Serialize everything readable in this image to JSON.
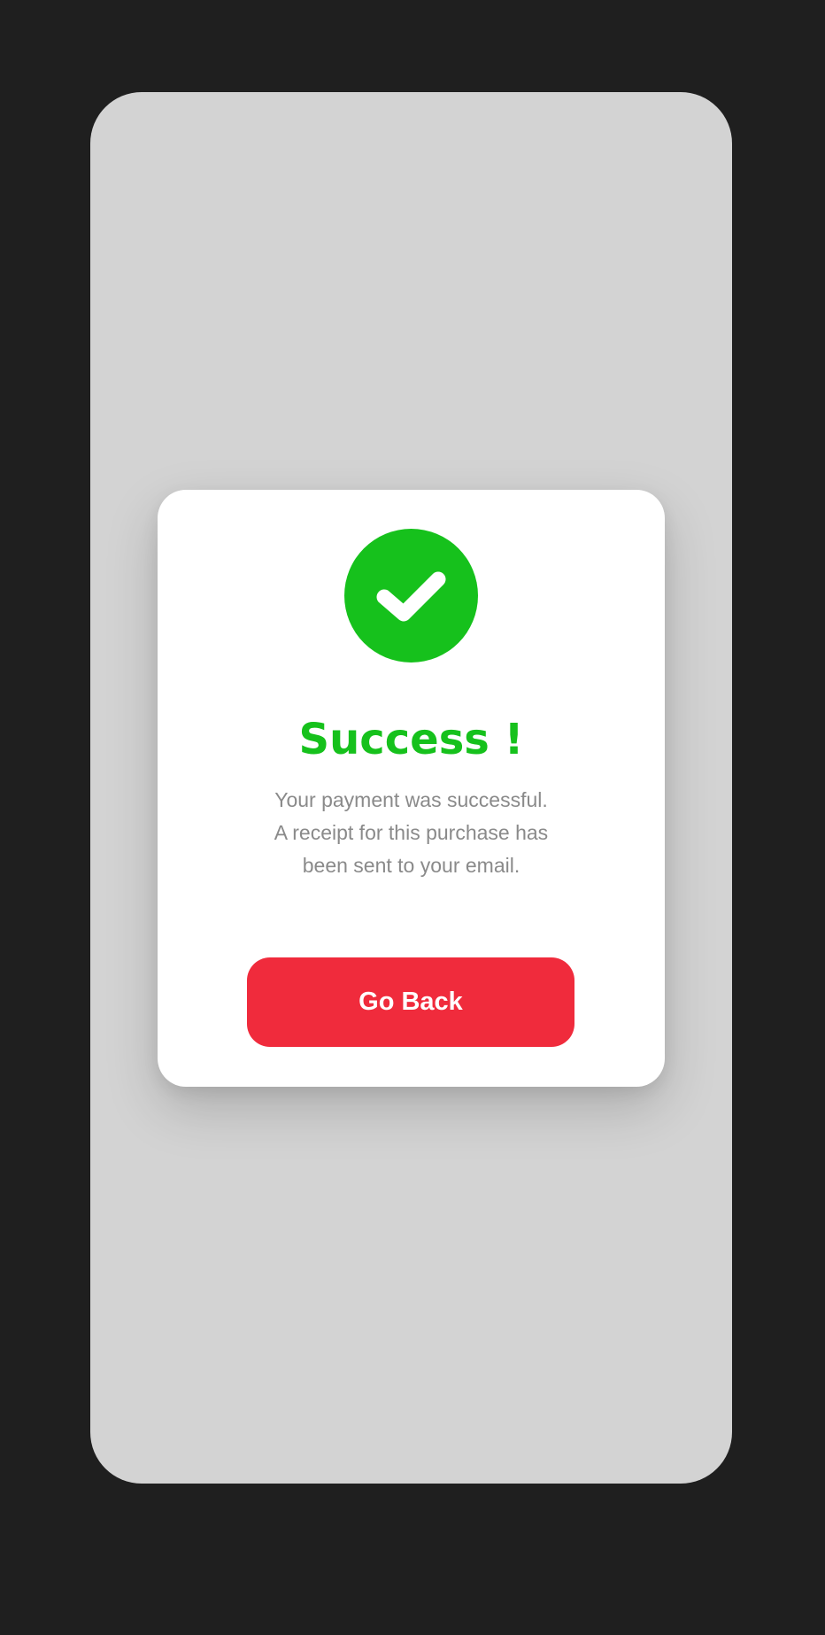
{
  "dialog": {
    "icon": "check-circle-icon",
    "title": "Success !",
    "message_lines": [
      "Your payment was successful.",
      "A receipt for this purchase has",
      "been sent to your email."
    ],
    "button_label": "Go Back"
  },
  "colors": {
    "page_background": "#1f1f1f",
    "phone_background": "#d3d3d3",
    "card_background": "#ffffff",
    "success_green": "#16c11c",
    "button_red": "#f02b3c",
    "message_gray": "#8a8a8a"
  }
}
